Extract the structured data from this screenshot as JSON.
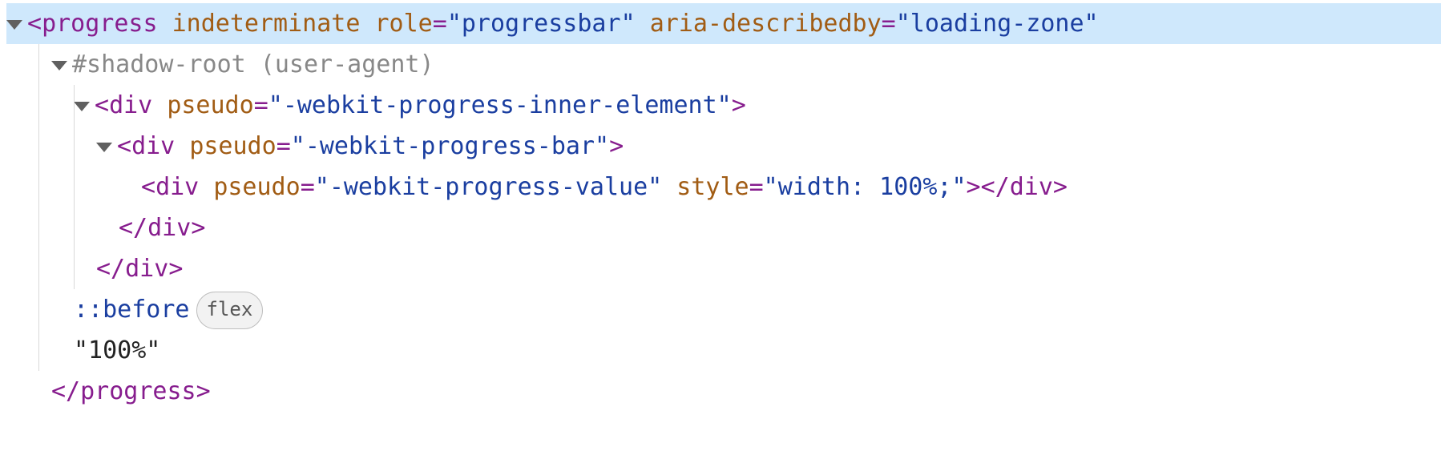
{
  "line1": {
    "tag_open": "<",
    "tag_name": "progress",
    "sp": " ",
    "attr1_name": "indeterminate",
    "attr2_name": "role",
    "eq": "=",
    "q": "\"",
    "attr2_value": "progressbar",
    "attr3_name": "aria-describedby",
    "attr3_value": "loading-zone"
  },
  "line2": {
    "text": "#shadow-root (user-agent)"
  },
  "line3": {
    "tag_open": "<",
    "tag_name": "div",
    "sp": " ",
    "attr_name": "pseudo",
    "eq": "=",
    "q": "\"",
    "attr_value": "-webkit-progress-inner-element",
    "tag_close": ">"
  },
  "line4": {
    "tag_open": "<",
    "tag_name": "div",
    "sp": " ",
    "attr_name": "pseudo",
    "eq": "=",
    "q": "\"",
    "attr_value": "-webkit-progress-bar",
    "tag_close": ">"
  },
  "line5": {
    "tag_open": "<",
    "tag_name": "div",
    "sp": " ",
    "attr1_name": "pseudo",
    "eq": "=",
    "q": "\"",
    "attr1_value": "-webkit-progress-value",
    "attr2_name": "style",
    "attr2_value": "width: 100%;",
    "close_empty": "></",
    "close_name": "div",
    "final_gt": ">"
  },
  "line6": {
    "close_open": "</",
    "name": "div",
    "gt": ">"
  },
  "line7": {
    "close_open": "</",
    "name": "div",
    "gt": ">"
  },
  "line8": {
    "pseudo": "::before",
    "badge": "flex"
  },
  "line9": {
    "text": "\"100%\""
  },
  "line10": {
    "close_open": "</",
    "name": "progress",
    "gt": ">"
  }
}
